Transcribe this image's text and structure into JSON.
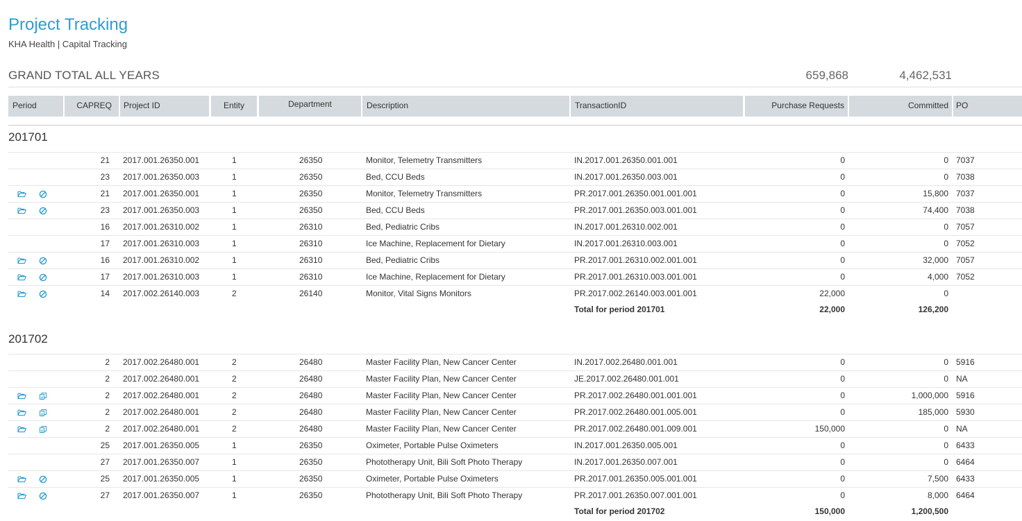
{
  "header": {
    "title": "Project Tracking",
    "subtitle": "KHA Health | Capital Tracking"
  },
  "grand_total": {
    "label": "GRAND TOTAL ALL YEARS",
    "purchase_requests": "659,868",
    "committed": "4,462,531"
  },
  "columns": {
    "period": "Period",
    "capreq": "CAPREQ",
    "project_id": "Project ID",
    "entity": "Entity",
    "department": "Department",
    "description": "Description",
    "transaction_id": "TransactionID",
    "purchase_requests": "Purchase Requests",
    "committed": "Committed",
    "po": "PO"
  },
  "icon_colors": {
    "accent": "#2a9fd0"
  },
  "periods": [
    {
      "label": "201701",
      "total_label": "Total for period 201701",
      "total_pr": "22,000",
      "total_committed": "126,200",
      "rows": [
        {
          "icons": [],
          "capreq": "21",
          "project_id": "2017.001.26350.001",
          "entity": "1",
          "department": "26350",
          "description": "Monitor, Telemetry Transmitters",
          "transaction_id": "IN.2017.001.26350.001.001",
          "pr": "0",
          "committed": "0",
          "po": "7037"
        },
        {
          "icons": [],
          "capreq": "23",
          "project_id": "2017.001.26350.003",
          "entity": "1",
          "department": "26350",
          "description": "Bed, CCU Beds",
          "transaction_id": "IN.2017.001.26350.003.001",
          "pr": "0",
          "committed": "0",
          "po": "7038"
        },
        {
          "icons": [
            "folder-open-icon",
            "cancel-icon"
          ],
          "capreq": "21",
          "project_id": "2017.001.26350.001",
          "entity": "1",
          "department": "26350",
          "description": "Monitor, Telemetry Transmitters",
          "transaction_id": "PR.2017.001.26350.001.001.001",
          "pr": "0",
          "committed": "15,800",
          "po": "7037"
        },
        {
          "icons": [
            "folder-open-icon",
            "cancel-icon"
          ],
          "capreq": "23",
          "project_id": "2017.001.26350.003",
          "entity": "1",
          "department": "26350",
          "description": "Bed, CCU Beds",
          "transaction_id": "PR.2017.001.26350.003.001.001",
          "pr": "0",
          "committed": "74,400",
          "po": "7038"
        },
        {
          "icons": [],
          "capreq": "16",
          "project_id": "2017.001.26310.002",
          "entity": "1",
          "department": "26310",
          "description": "Bed, Pediatric Cribs",
          "transaction_id": "IN.2017.001.26310.002.001",
          "pr": "0",
          "committed": "0",
          "po": "7057"
        },
        {
          "icons": [],
          "capreq": "17",
          "project_id": "2017.001.26310.003",
          "entity": "1",
          "department": "26310",
          "description": "Ice Machine, Replacement for Dietary",
          "transaction_id": "IN.2017.001.26310.003.001",
          "pr": "0",
          "committed": "0",
          "po": "7052"
        },
        {
          "icons": [
            "folder-open-icon",
            "cancel-icon"
          ],
          "capreq": "16",
          "project_id": "2017.001.26310.002",
          "entity": "1",
          "department": "26310",
          "description": "Bed, Pediatric Cribs",
          "transaction_id": "PR.2017.001.26310.002.001.001",
          "pr": "0",
          "committed": "32,000",
          "po": "7057"
        },
        {
          "icons": [
            "folder-open-icon",
            "cancel-icon"
          ],
          "capreq": "17",
          "project_id": "2017.001.26310.003",
          "entity": "1",
          "department": "26310",
          "description": "Ice Machine, Replacement for Dietary",
          "transaction_id": "PR.2017.001.26310.003.001.001",
          "pr": "0",
          "committed": "4,000",
          "po": "7052"
        },
        {
          "icons": [
            "folder-open-icon",
            "cancel-icon"
          ],
          "capreq": "14",
          "project_id": "2017.002.26140.003",
          "entity": "2",
          "department": "26140",
          "description": "Monitor, Vital Signs Monitors",
          "transaction_id": "PR.2017.002.26140.003.001.001",
          "pr": "22,000",
          "committed": "0",
          "po": ""
        }
      ]
    },
    {
      "label": "201702",
      "total_label": "Total for period 201702",
      "total_pr": "150,000",
      "total_committed": "1,200,500",
      "rows": [
        {
          "icons": [],
          "capreq": "2",
          "project_id": "2017.002.26480.001",
          "entity": "2",
          "department": "26480",
          "description": "Master Facility Plan, New Cancer Center",
          "transaction_id": "IN.2017.002.26480.001.001",
          "pr": "0",
          "committed": "0",
          "po": "5916"
        },
        {
          "icons": [],
          "capreq": "2",
          "project_id": "2017.002.26480.001",
          "entity": "2",
          "department": "26480",
          "description": "Master Facility Plan, New Cancer Center",
          "transaction_id": "JE.2017.002.26480.001.001",
          "pr": "0",
          "committed": "0",
          "po": "NA"
        },
        {
          "icons": [
            "folder-open-icon",
            "copy-icon"
          ],
          "capreq": "2",
          "project_id": "2017.002.26480.001",
          "entity": "2",
          "department": "26480",
          "description": "Master Facility Plan, New Cancer Center",
          "transaction_id": "PR.2017.002.26480.001.001.001",
          "pr": "0",
          "committed": "1,000,000",
          "po": "5916"
        },
        {
          "icons": [
            "folder-open-icon",
            "copy-icon"
          ],
          "capreq": "2",
          "project_id": "2017.002.26480.001",
          "entity": "2",
          "department": "26480",
          "description": "Master Facility Plan, New Cancer Center",
          "transaction_id": "PR.2017.002.26480.001.005.001",
          "pr": "0",
          "committed": "185,000",
          "po": "5930"
        },
        {
          "icons": [
            "folder-open-icon",
            "copy-icon"
          ],
          "capreq": "2",
          "project_id": "2017.002.26480.001",
          "entity": "2",
          "department": "26480",
          "description": "Master Facility Plan, New Cancer Center",
          "transaction_id": "PR.2017.002.26480.001.009.001",
          "pr": "150,000",
          "committed": "0",
          "po": "NA"
        },
        {
          "icons": [],
          "capreq": "25",
          "project_id": "2017.001.26350.005",
          "entity": "1",
          "department": "26350",
          "description": "Oximeter, Portable Pulse Oximeters",
          "transaction_id": "IN.2017.001.26350.005.001",
          "pr": "0",
          "committed": "0",
          "po": "6433"
        },
        {
          "icons": [],
          "capreq": "27",
          "project_id": "2017.001.26350.007",
          "entity": "1",
          "department": "26350",
          "description": "Phototherapy Unit, Bili Soft Photo Therapy",
          "transaction_id": "IN.2017.001.26350.007.001",
          "pr": "0",
          "committed": "0",
          "po": "6464"
        },
        {
          "icons": [
            "folder-open-icon",
            "cancel-icon"
          ],
          "capreq": "25",
          "project_id": "2017.001.26350.005",
          "entity": "1",
          "department": "26350",
          "description": "Oximeter, Portable Pulse Oximeters",
          "transaction_id": "PR.2017.001.26350.005.001.001",
          "pr": "0",
          "committed": "7,500",
          "po": "6433"
        },
        {
          "icons": [
            "folder-open-icon",
            "cancel-icon"
          ],
          "capreq": "27",
          "project_id": "2017.001.26350.007",
          "entity": "1",
          "department": "26350",
          "description": "Phototherapy Unit, Bili Soft Photo Therapy",
          "transaction_id": "PR.2017.001.26350.007.001.001",
          "pr": "0",
          "committed": "8,000",
          "po": "6464"
        }
      ]
    }
  ]
}
